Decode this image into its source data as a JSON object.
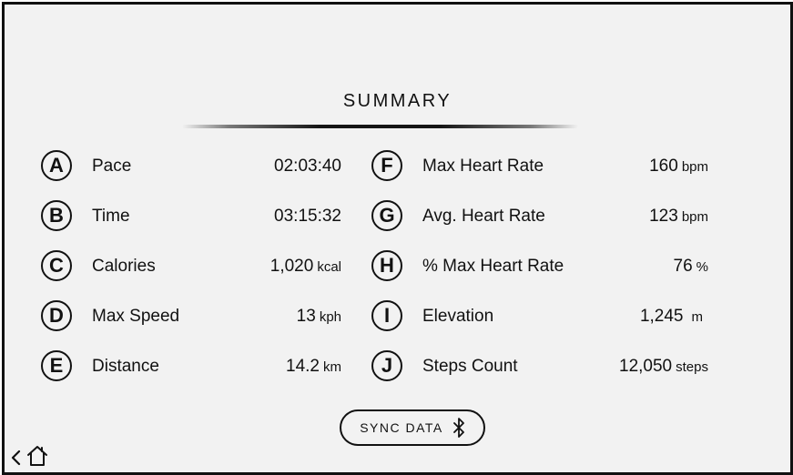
{
  "title": "SUMMARY",
  "stats_left": [
    {
      "badge": "A",
      "label": "Pace",
      "value": "02:03:40",
      "unit": ""
    },
    {
      "badge": "B",
      "label": "Time",
      "value": "03:15:32",
      "unit": ""
    },
    {
      "badge": "C",
      "label": "Calories",
      "value": "1,020",
      "unit": "kcal"
    },
    {
      "badge": "D",
      "label": "Max Speed",
      "value": "13",
      "unit": "kph"
    },
    {
      "badge": "E",
      "label": "Distance",
      "value": "14.2",
      "unit": "km"
    }
  ],
  "stats_right": [
    {
      "badge": "F",
      "label": "Max Heart Rate",
      "value": "160",
      "unit": "bpm"
    },
    {
      "badge": "G",
      "label": "Avg. Heart Rate",
      "value": "123",
      "unit": "bpm"
    },
    {
      "badge": "H",
      "label": "% Max Heart Rate",
      "value": "76",
      "unit": "%"
    },
    {
      "badge": "I",
      "label": "Elevation",
      "value": "1,245",
      "unit": "m"
    },
    {
      "badge": "J",
      "label": "Steps Count",
      "value": "12,050",
      "unit": "steps"
    }
  ],
  "sync_button": {
    "label": "SYNC DATA",
    "icon": "bluetooth-icon"
  },
  "nav": {
    "back_icon": "chevron-left-icon",
    "home_icon": "home-icon"
  }
}
